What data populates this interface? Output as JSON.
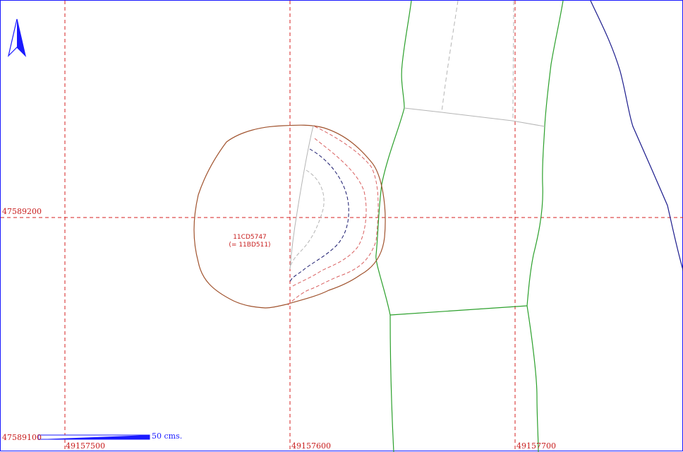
{
  "colors": {
    "grid": "#d42020",
    "grid_label": "#c81e1e",
    "parcel_outline": "#a0522d",
    "field_boundary": "#2ca02c",
    "river": "#1a1a8c",
    "north_arrow": "#1a1aff",
    "inner_contour_red": "#d96060",
    "inner_contour_navy": "#1a1a6e",
    "inner_contour_grey": "#b5b5b5",
    "frame": "#1a1aff"
  },
  "grid": {
    "northings": [
      "47589200",
      "47589100"
    ],
    "eastings": [
      "49157500",
      "49157600",
      "49157700"
    ]
  },
  "feature": {
    "id_label": "11CD5747",
    "alias_label": "(= 11BD511)"
  },
  "scale_bar": {
    "label": "50 cms."
  },
  "north_arrow": {
    "icon": "north-arrow-icon"
  }
}
